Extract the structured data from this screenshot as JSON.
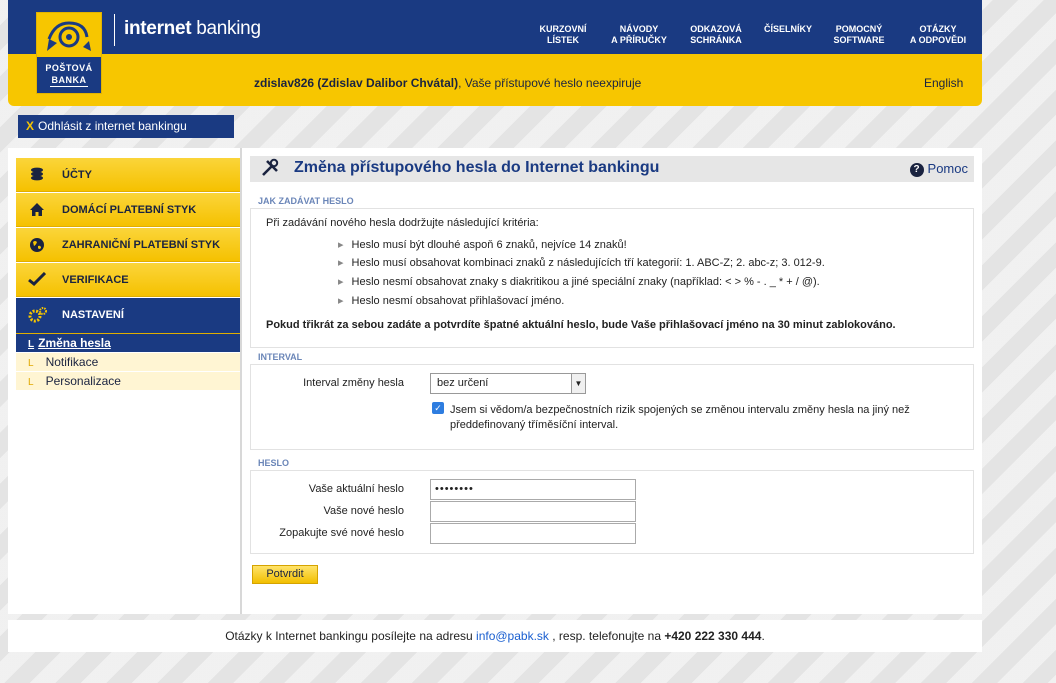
{
  "header": {
    "logo_line1": "POŠTOVÁ",
    "logo_line2": "BANKA",
    "app_title_bold": "internet",
    "app_title_rest": " banking",
    "nav": [
      {
        "label": "KURZOVNÍ\nLÍSTEK"
      },
      {
        "label": "NÁVODY\nA PŘÍRUČKY"
      },
      {
        "label": "ODKAZOVÁ\nSCHRÁNKA"
      },
      {
        "label": "ČÍSELNÍKY"
      },
      {
        "label": "POMOCNÝ\nSOFTWARE"
      },
      {
        "label": "OTÁZKY\nA ODPOVĚDI"
      }
    ],
    "user_bold": "zdislav826 (Zdislav Dalibor Chvátal)",
    "user_rest": ", Vaše přístupové heslo neexpiruje",
    "lang_link": "English"
  },
  "logout": {
    "label": "Odhlásit z internet bankingu"
  },
  "sidebar": {
    "items": [
      {
        "label": "ÚČTY",
        "icon": "coins-icon"
      },
      {
        "label": "DOMÁCÍ PLATEBNÍ STYK",
        "icon": "home-icon"
      },
      {
        "label": "ZAHRANIČNÍ PLATEBNÍ STYK",
        "icon": "globe-icon"
      },
      {
        "label": "VERIFIKACE",
        "icon": "check-icon"
      },
      {
        "label": "NASTAVENÍ",
        "icon": "gears-icon"
      }
    ],
    "subitems": [
      {
        "label": "Změna hesla"
      },
      {
        "label": "Notifikace"
      },
      {
        "label": "Personalizace"
      }
    ]
  },
  "content": {
    "title": "Změna přístupového hesla do Internet bankingu",
    "help": "Pomoc",
    "criteria_head": "JAK ZADÁVAT HESLO",
    "criteria_intro": "Při zadávání nového hesla dodržujte následující kritéria:",
    "criteria": [
      "Heslo musí být dlouhé aspoň 6 znaků, nejvíce 14 znaků!",
      "Heslo musí obsahovat kombinaci znaků z následujících tří kategorií: 1. ABC-Z; 2. abc-z; 3. 012-9.",
      "Heslo nesmí obsahovat znaky s diakritikou a jiné speciální znaky (například: < > % - . _ * + / @).",
      "Heslo nesmí obsahovat přihlašovací jméno."
    ],
    "warning": "Pokud třikrát za sebou zadáte a potvrdíte špatné aktuální heslo, bude Vaše přihlašovací jméno na 30 minut zablokováno.",
    "interval_head": "INTERVAL",
    "interval_label": "Interval změny hesla",
    "interval_value": "bez určení",
    "interval_checkbox_label": "Jsem si vědom/a bezpečnostních rizik spojených se změnou intervalu změny hesla na jiný než předdefinovaný tříměsíční interval.",
    "interval_checked": true,
    "password_head": "HESLO",
    "current_label": "Vaše aktuální heslo",
    "current_value": "••••••••",
    "new_label": "Vaše nové heslo",
    "new_value": "",
    "confirm_label": "Zopakujte své nové heslo",
    "confirm_value": "",
    "submit": "Potvrdit"
  },
  "footer": {
    "text1": "Otázky k Internet bankingu posílejte na adresu ",
    "email": "info@pabk.sk",
    "text2": " , resp. telefonujte na ",
    "phone": "+420 222 330 444",
    "text3": "."
  },
  "colors": {
    "brand_blue": "#1a3a82",
    "brand_yellow": "#f7c600"
  }
}
